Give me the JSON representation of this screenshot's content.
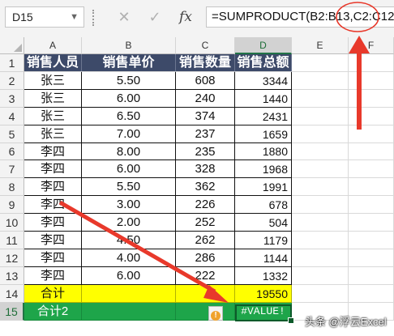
{
  "name_box": "D15",
  "icons": {
    "name_dropdown": "chevron-down-icon",
    "cancel": "close-icon",
    "enter": "check-icon",
    "function": "fx-icon"
  },
  "formula_bar": {
    "fx_label": "fx",
    "formula": "=SUMPRODUCT(B2:B13,C2:C12)"
  },
  "columns": [
    "A",
    "B",
    "C",
    "D",
    "E",
    "F"
  ],
  "rows": [
    "1",
    "2",
    "3",
    "4",
    "5",
    "6",
    "7",
    "8",
    "9",
    "10",
    "11",
    "12",
    "13",
    "14",
    "15"
  ],
  "header": [
    "销售人员",
    "销售单价",
    "销售数量",
    "销售总额"
  ],
  "table": [
    [
      "张三",
      "5.50",
      "608",
      "3344"
    ],
    [
      "张三",
      "6.00",
      "240",
      "1440"
    ],
    [
      "张三",
      "6.50",
      "374",
      "2431"
    ],
    [
      "张三",
      "7.00",
      "237",
      "1659"
    ],
    [
      "李四",
      "8.00",
      "235",
      "1880"
    ],
    [
      "李四",
      "6.00",
      "328",
      "1968"
    ],
    [
      "李四",
      "5.50",
      "362",
      "1991"
    ],
    [
      "李四",
      "3.00",
      "226",
      "678"
    ],
    [
      "李四",
      "2.00",
      "252",
      "504"
    ],
    [
      "李四",
      "4.50",
      "262",
      "1179"
    ],
    [
      "李四",
      "4.00",
      "286",
      "1144"
    ],
    [
      "李四",
      "6.00",
      "222",
      "1332"
    ]
  ],
  "total_row": {
    "label": "合计",
    "value": "19550"
  },
  "total2_row": {
    "label": "合计2",
    "value": "#VALUE!"
  },
  "colors": {
    "header_bg": "#3d4a69",
    "yellow": "#ffff00",
    "green": "#1ea54a",
    "arrow": "#e8392b"
  },
  "watermark": "头条 @浮云Excel"
}
